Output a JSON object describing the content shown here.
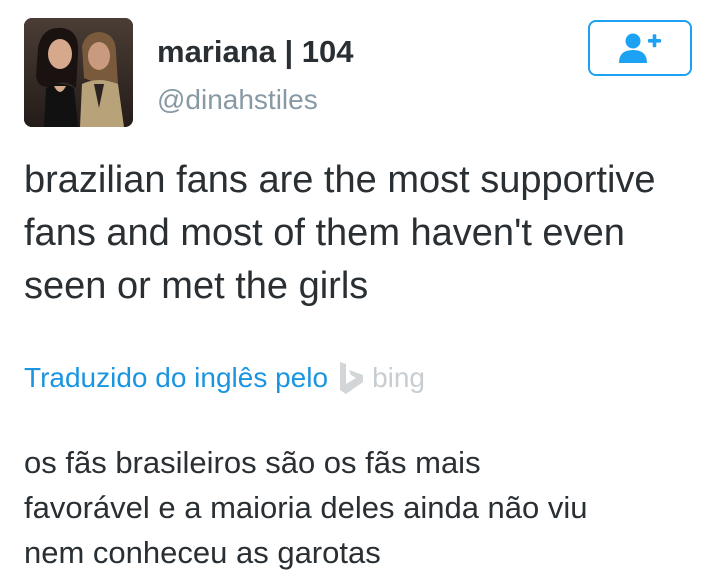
{
  "user": {
    "display_name": "mariana | 104",
    "handle": "@dinahstiles",
    "avatar_icon": "profile-photo"
  },
  "follow_button": {
    "icon": "add-user-icon",
    "color": "#1da1f2"
  },
  "tweet": {
    "text": "brazilian fans are the most supportive\nfans and most of them haven't even\nseen or met the girls"
  },
  "translation": {
    "translated_by": "Traduzido do inglês pelo",
    "provider": "bing",
    "provider_icon": "bing-logo-icon",
    "text": "os fãs brasileiros são os fãs mais\nfavorável e a maioria deles ainda não viu\nnem conheceu as garotas",
    "link_color": "#1b95e0"
  }
}
